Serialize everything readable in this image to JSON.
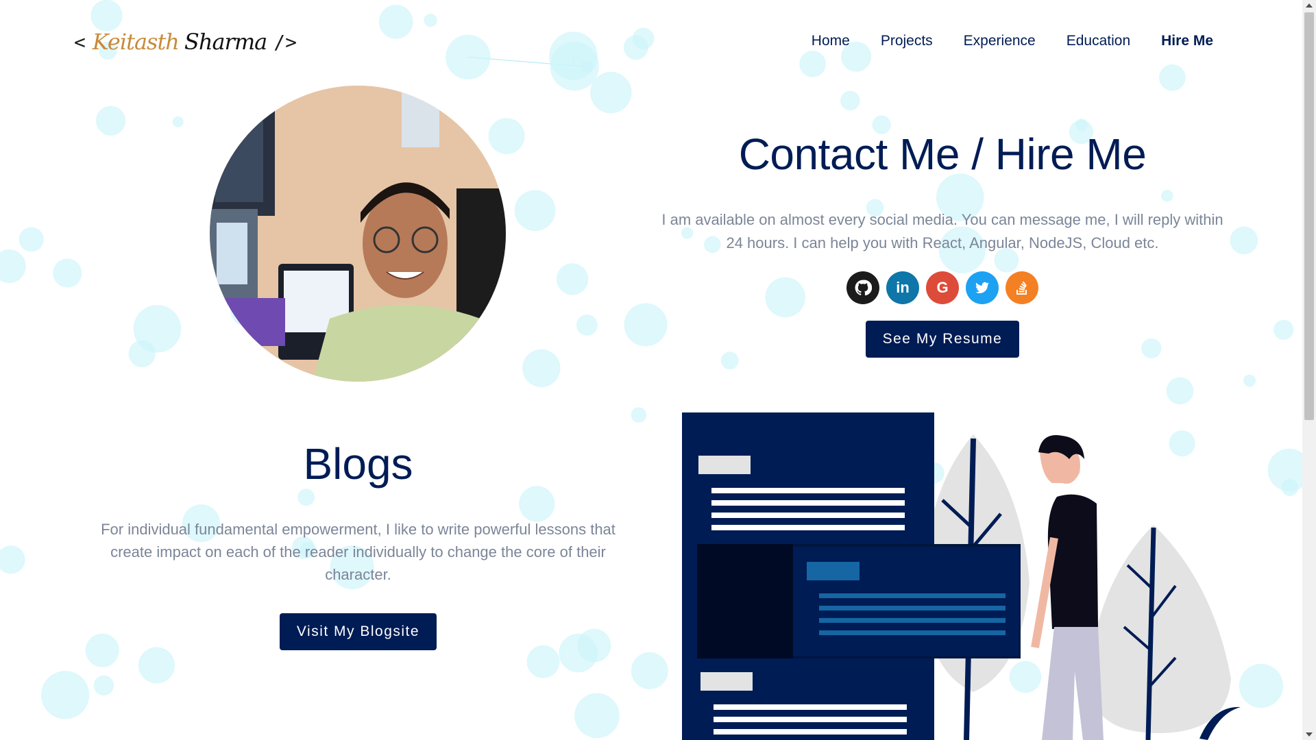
{
  "header": {
    "logo": {
      "open": "<",
      "first_name": "Keitasth",
      "last_name": "Sharma",
      "close": "/>"
    },
    "nav": [
      "Home",
      "Projects",
      "Experience",
      "Education",
      "Hire Me"
    ],
    "active_nav": "Hire Me"
  },
  "contact": {
    "title": "Contact Me / Hire Me",
    "text": "I am available on almost every social media. You can message me, I will reply within 24 hours. I can help you with React, Angular, NodeJS, Cloud etc.",
    "socials": [
      {
        "name": "github",
        "icon": "github-icon",
        "color": "#1b1b1b"
      },
      {
        "name": "linkedin",
        "icon": "linkedin-icon",
        "color": "#0e76a8",
        "glyph": "in"
      },
      {
        "name": "google",
        "icon": "google-icon",
        "color": "#dd4b39",
        "glyph": "G"
      },
      {
        "name": "twitter",
        "icon": "twitter-icon",
        "color": "#1da1f2"
      },
      {
        "name": "stack-overflow",
        "icon": "stack-overflow-icon",
        "color": "#f48024"
      }
    ],
    "resume_button": "See My Resume"
  },
  "blogs": {
    "title": "Blogs",
    "text": "For individual fundamental empowerment, I like to write powerful lessons that create impact on each of the reader individually to change the core of their character.",
    "button": "Visit My Blogsite"
  },
  "colors": {
    "primary": "#001c55",
    "body_text": "#7b8598",
    "bubble": "#cdf5fb",
    "line": "#b6ecf5"
  }
}
